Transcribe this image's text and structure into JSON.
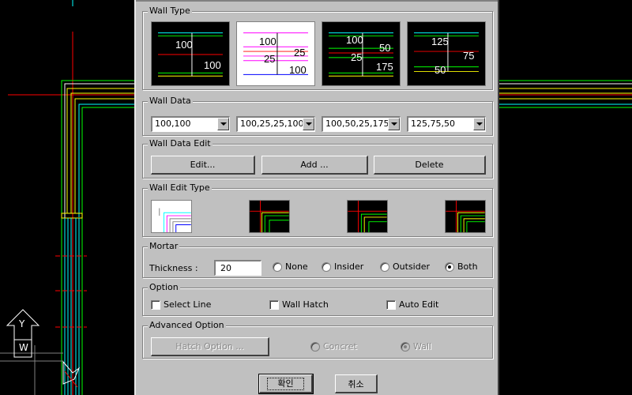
{
  "wall_type": {
    "title": "Wall Type",
    "presets": [
      {
        "labels": [
          "100",
          "100"
        ],
        "selected": false
      },
      {
        "labels": [
          "100",
          "25",
          "25",
          "100"
        ],
        "selected": true
      },
      {
        "labels": [
          "100",
          "50",
          "25",
          "175"
        ],
        "selected": false
      },
      {
        "labels": [
          "125",
          "75",
          "50"
        ],
        "selected": false
      }
    ]
  },
  "wall_data": {
    "title": "Wall Data",
    "combos": [
      "100,100",
      "100,25,25,100",
      "100,50,25,175",
      "125,75,50"
    ]
  },
  "wall_data_edit": {
    "title": "Wall Data Edit",
    "edit_label": "Edit...",
    "add_label": "Add ...",
    "delete_label": "Delete"
  },
  "wall_edit_type": {
    "title": "Wall Edit Type",
    "selected_index": 0
  },
  "mortar": {
    "title": "Mortar",
    "thickness_label": "Thickness :",
    "thickness_value": "20",
    "options": [
      "None",
      "Insider",
      "Outsider",
      "Both"
    ],
    "selected": "Both"
  },
  "option": {
    "title": "Option",
    "select_line": "Select Line",
    "wall_hatch": "Wall Hatch",
    "auto_edit": "Auto Edit"
  },
  "advanced_option": {
    "title": "Advanced Option",
    "hatch_option_label": "Hatch Option ...",
    "concret_label": "Concret",
    "wall_label": "Wall",
    "selected": "Wall"
  },
  "footer": {
    "ok_label": "확인",
    "cancel_label": "취소"
  },
  "cad_background": {
    "ucs_y_label": "Y",
    "ucs_w_label": "W"
  },
  "colors": {
    "dialog_face": "#c0c0c0",
    "cad_background": "#000000",
    "cad_yellow": "#ffff00",
    "cad_cyan": "#00ffff",
    "cad_red": "#ff0000",
    "cad_white": "#ffffff",
    "cad_green": "#00ff00"
  }
}
